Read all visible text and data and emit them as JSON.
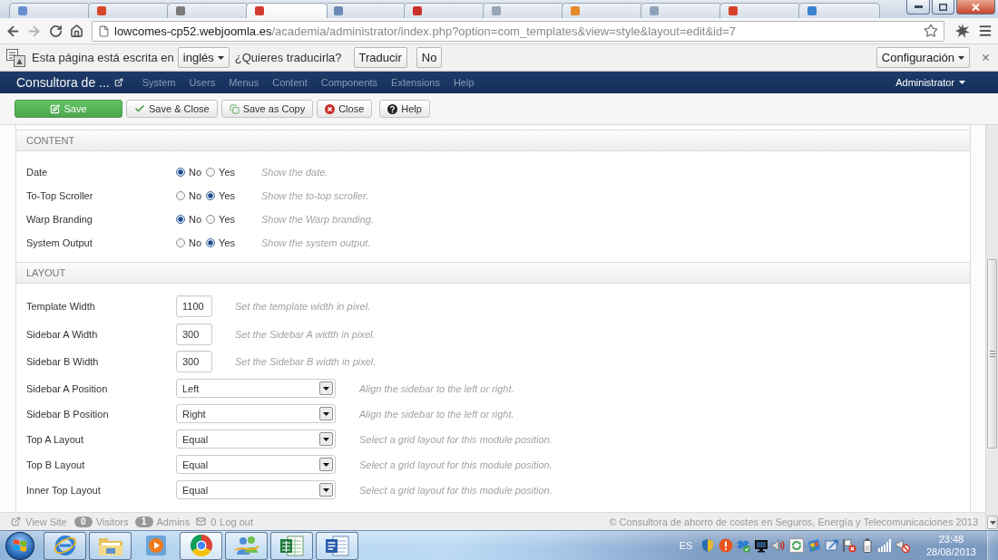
{
  "browser_tabs": [
    {
      "selected": false
    },
    {
      "selected": false
    },
    {
      "selected": false
    },
    {
      "selected": true
    },
    {
      "selected": false
    },
    {
      "selected": false
    },
    {
      "selected": false
    },
    {
      "selected": false
    },
    {
      "selected": false
    },
    {
      "selected": false
    },
    {
      "selected": false
    }
  ],
  "address_bar": {
    "host": "lowcomes-cp52.webjoomla.es",
    "path": "/academia/administrator/index.php?option=com_templates&view=style&layout=edit&id=7"
  },
  "translate_bar": {
    "message": "Esta página está escrita en",
    "language": "inglés",
    "question": "¿Quieres traducirla?",
    "buttons": [
      "Traducir",
      "No"
    ],
    "settings": "Configuración"
  },
  "admin_nav": {
    "site_name": "Consultora de ...",
    "menu": [
      "System",
      "Users",
      "Menus",
      "Content",
      "Components",
      "Extensions",
      "Help"
    ],
    "user": "Administrator"
  },
  "toolbar": [
    {
      "kind": "save",
      "label": "Save"
    },
    {
      "kind": "apply",
      "label": "Save & Close"
    },
    {
      "kind": "copy",
      "label": "Save as Copy"
    },
    {
      "kind": "close",
      "label": "Close"
    },
    {
      "kind": "help",
      "label": "Help"
    }
  ],
  "sections": [
    {
      "title": "CONTENT",
      "fields": [
        {
          "kind": "radio",
          "label": "Date",
          "options": [
            {
              "label": "No",
              "selected": true
            },
            {
              "label": "Yes",
              "selected": false
            }
          ],
          "description": "Show the date."
        },
        {
          "kind": "radio",
          "label": "To-Top Scroller",
          "options": [
            {
              "label": "No",
              "selected": false
            },
            {
              "label": "Yes",
              "selected": true
            }
          ],
          "description": "Show the to-top scroller."
        },
        {
          "kind": "radio",
          "label": "Warp Branding",
          "options": [
            {
              "label": "No",
              "selected": true
            },
            {
              "label": "Yes",
              "selected": false
            }
          ],
          "description": "Show the Warp branding."
        },
        {
          "kind": "radio",
          "label": "System Output",
          "options": [
            {
              "label": "No",
              "selected": false
            },
            {
              "label": "Yes",
              "selected": true
            }
          ],
          "description": "Show the system output."
        }
      ]
    },
    {
      "title": "LAYOUT",
      "fields": [
        {
          "kind": "text",
          "label": "Template Width",
          "value": "1100",
          "description": "Set the template width in pixel."
        },
        {
          "kind": "text",
          "label": "Sidebar A Width",
          "value": "300",
          "description": "Set the Sidebar A width in pixel."
        },
        {
          "kind": "text",
          "label": "Sidebar B Width",
          "value": "300",
          "description": "Set the Sidebar B width in pixel."
        },
        {
          "kind": "select",
          "label": "Sidebar A Position",
          "value": "Left",
          "description": "Align the sidebar to the left or right."
        },
        {
          "kind": "select",
          "label": "Sidebar B Position",
          "value": "Right",
          "description": "Align the sidebar to the left or right."
        },
        {
          "kind": "select",
          "label": "Top A Layout",
          "value": "Equal",
          "description": "Select a grid layout for this module position."
        },
        {
          "kind": "select",
          "label": "Top B Layout",
          "value": "Equal",
          "description": "Select a grid layout for this module position."
        },
        {
          "kind": "select",
          "label": "Inner Top Layout",
          "value": "Equal",
          "description": "Select a grid layout for this module position."
        }
      ]
    }
  ],
  "status_bar": {
    "view_site": "View Site",
    "visitors": {
      "count": "0",
      "label": "Visitors"
    },
    "admins": {
      "count": "1",
      "label": "Admins"
    },
    "messages": "0",
    "logout": "Log out",
    "copyright": "© Consultora de ahorro de costes en Seguros, Energía y Telecomunicaciones 2013"
  },
  "taskbar": {
    "apps": [
      {
        "kind": "orbit",
        "running": true,
        "selected": false
      },
      {
        "kind": "folder",
        "running": true,
        "selected": false
      },
      {
        "kind": "player",
        "running": false,
        "selected": false
      },
      {
        "kind": "wheel",
        "running": true,
        "selected": true
      },
      {
        "kind": "people",
        "running": true,
        "selected": false
      },
      {
        "kind": "sheet",
        "running": true,
        "selected": false
      },
      {
        "kind": "document",
        "running": true,
        "selected": false
      }
    ],
    "language": "ES",
    "time": "23:48",
    "date": "28/08/2013"
  }
}
